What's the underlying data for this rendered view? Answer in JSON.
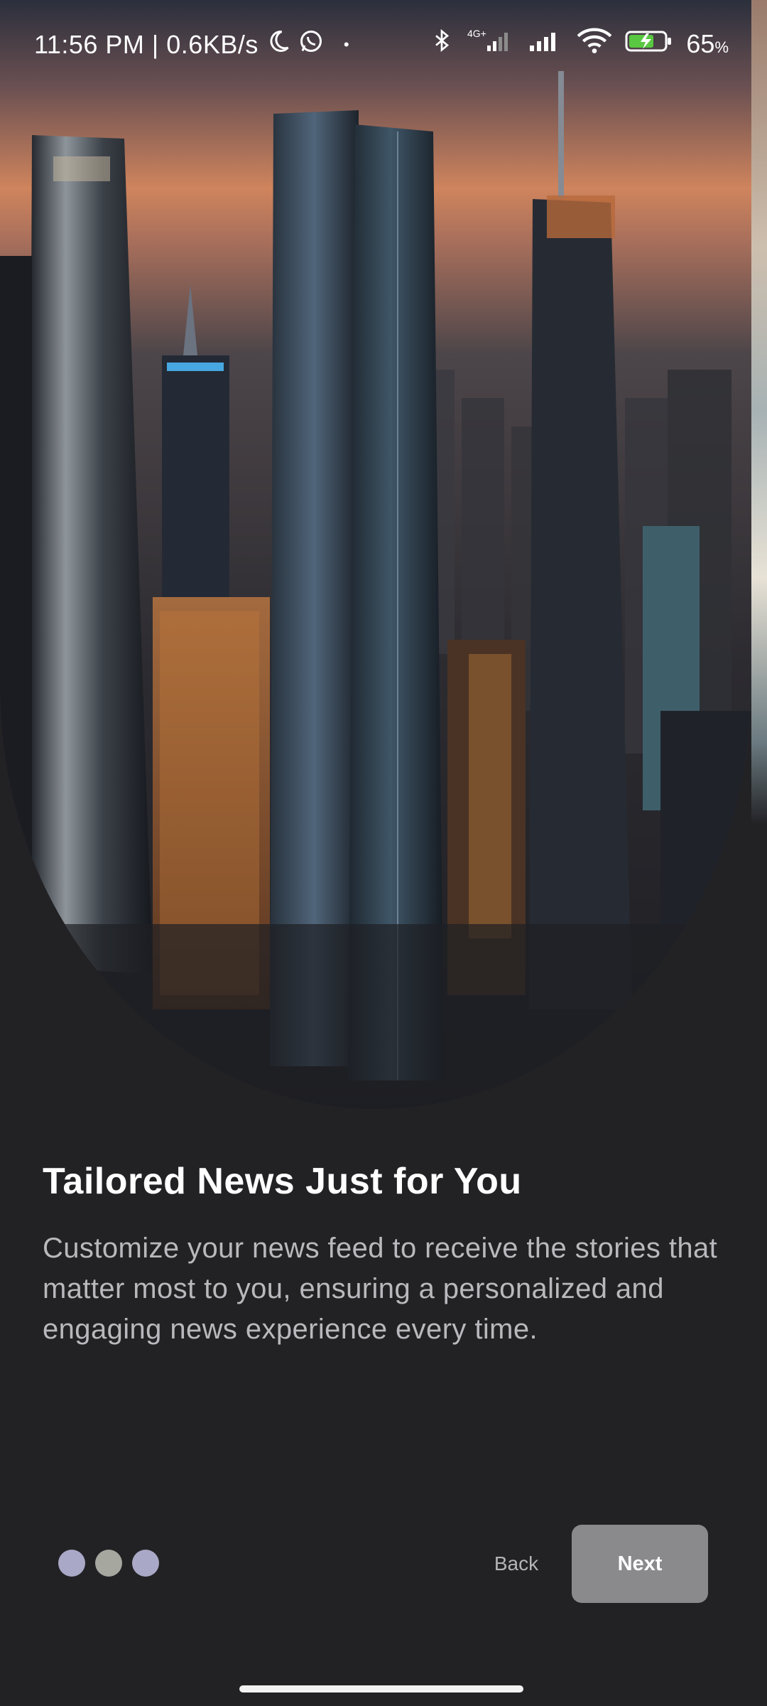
{
  "status_bar": {
    "time_speed": "11:56 PM | 0.6KB/s",
    "dot": "•",
    "battery_percent": "65",
    "battery_unit": "%",
    "network_label": "4G+",
    "icons": [
      "moon-icon",
      "whatsapp-icon",
      "bluetooth-icon",
      "signal-4g-icon",
      "signal-icon",
      "wifi-icon",
      "battery-charging-icon"
    ]
  },
  "onboarding": {
    "title": "Tailored News Just for You",
    "description": "Customize your news feed to receive the stories that matter most to you, ensuring a personalized and engaging news experience every time."
  },
  "pager": {
    "total": 3,
    "dot_colors": [
      "#a9a8c6",
      "#a6a8a0",
      "#a9a8c6"
    ]
  },
  "actions": {
    "back_label": "Back",
    "next_label": "Next"
  },
  "colors": {
    "background": "#222225",
    "next_button": "#8a8a8d",
    "title": "#ffffff",
    "description": "#b9b9bd"
  }
}
